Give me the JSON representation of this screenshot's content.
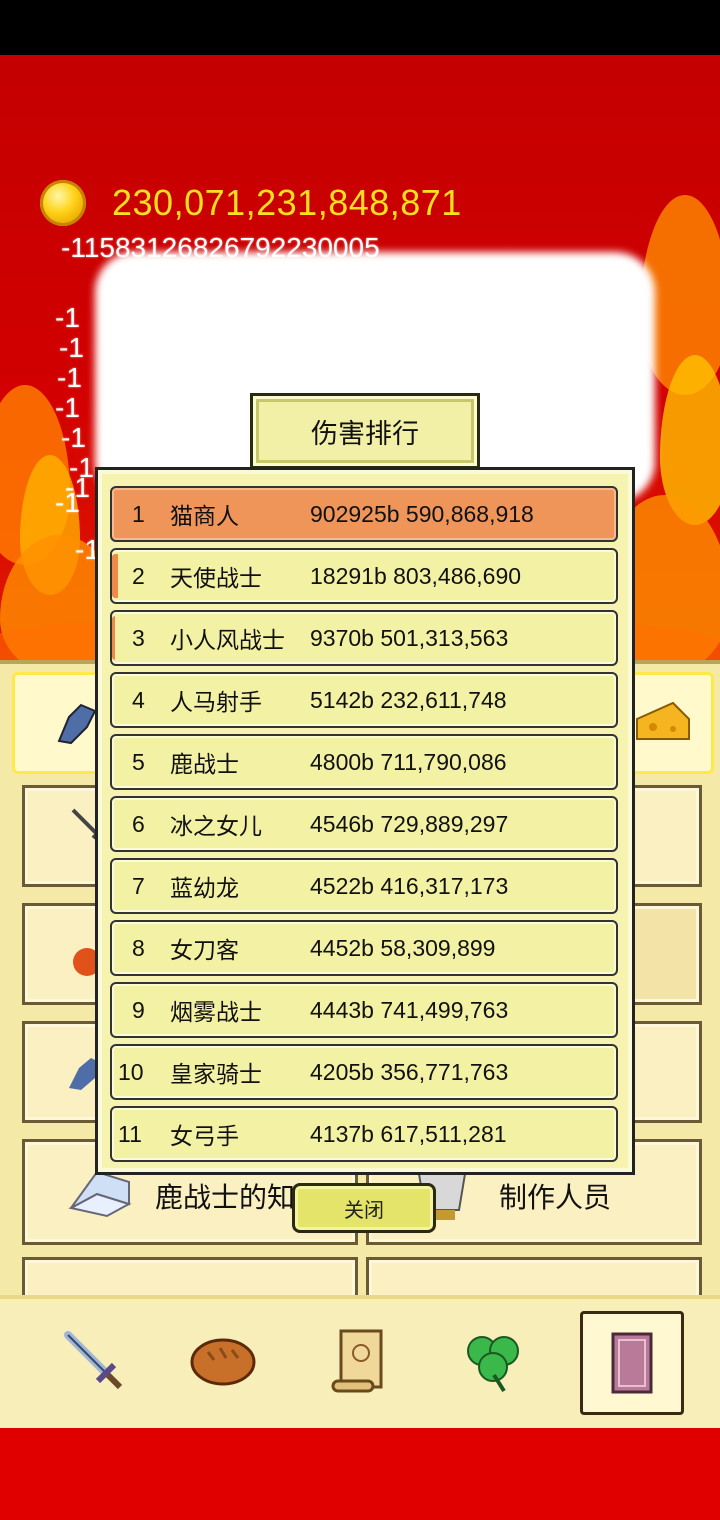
{
  "currency": {
    "amount": "230,071,231,848,871",
    "icon": "gold-coin-icon"
  },
  "damage_popups": [
    "-11583126826792230005",
    "-1",
    "-1",
    "-1",
    "-1",
    "-1",
    "-1",
    "-1",
    "-1",
    "-1"
  ],
  "ranking": {
    "title": "伤害排行",
    "rows": [
      {
        "rank": "1",
        "name": "猫商人",
        "damage": "902925b 590,868,918"
      },
      {
        "rank": "2",
        "name": "天使战士",
        "damage": "18291b 803,486,690"
      },
      {
        "rank": "3",
        "name": "小人风战士",
        "damage": "9370b 501,313,563"
      },
      {
        "rank": "4",
        "name": "人马射手",
        "damage": "5142b 232,611,748"
      },
      {
        "rank": "5",
        "name": "鹿战士",
        "damage": "4800b 711,790,086"
      },
      {
        "rank": "6",
        "name": "冰之女儿",
        "damage": "4546b 729,889,297"
      },
      {
        "rank": "7",
        "name": "蓝幼龙",
        "damage": "4522b 416,317,173"
      },
      {
        "rank": "8",
        "name": "女刀客",
        "damage": "4452b 58,309,899"
      },
      {
        "rank": "9",
        "name": "烟雾战士",
        "damage": "4443b 741,499,763"
      },
      {
        "rank": "10",
        "name": "皇家骑士",
        "damage": "4205b 356,771,763"
      },
      {
        "rank": "11",
        "name": "女弓手",
        "damage": "4137b 617,511,281"
      }
    ],
    "close_label": "关闭"
  },
  "under_menu": {
    "card_left_label": "鹿战士的知识",
    "card_right_label": "制作人员"
  },
  "bottom_nav": [
    {
      "name": "sword-icon"
    },
    {
      "name": "bread-icon"
    },
    {
      "name": "scroll-icon"
    },
    {
      "name": "clover-icon"
    },
    {
      "name": "book-icon"
    }
  ],
  "colors": {
    "background_red": "#d40000",
    "coin_text": "#ffe020",
    "panel": "#f6f3b0",
    "top_row": "#f0955a"
  }
}
